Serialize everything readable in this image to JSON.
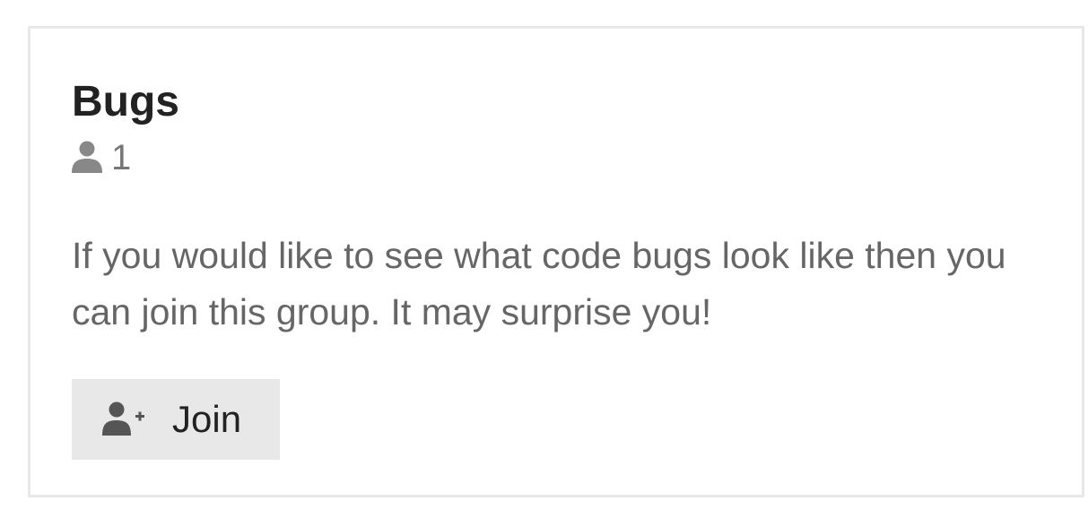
{
  "group": {
    "title": "Bugs",
    "member_count": "1",
    "member_icon": "user-icon",
    "description": "If you would like to see what code bugs look like then you can join this group. It may surprise you!"
  },
  "join_button": {
    "label": "Join",
    "icon": "user-plus-icon"
  },
  "colors": {
    "card_border": "#e8e8e8",
    "button_background": "#e8e8e8",
    "title_text": "#222222",
    "muted_text": "#666666",
    "icon_gray": "#888888"
  }
}
